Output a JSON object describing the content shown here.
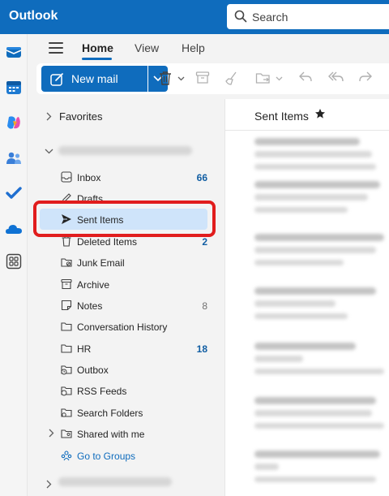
{
  "app": {
    "title": "Outlook"
  },
  "search": {
    "placeholder": "Search"
  },
  "rail": {
    "icons": [
      "mail-icon",
      "calendar-icon",
      "copilot-icon",
      "people-icon",
      "todo-icon",
      "onedrive-icon",
      "apps-icon"
    ]
  },
  "ribbon": {
    "tabs": [
      {
        "label": "Home",
        "active": true
      },
      {
        "label": "View",
        "active": false
      },
      {
        "label": "Help",
        "active": false
      }
    ]
  },
  "toolbar": {
    "new_mail_label": "New mail"
  },
  "folders": {
    "favorites_label": "Favorites",
    "items": [
      {
        "label": "Inbox",
        "count": "66",
        "icon": "inbox-icon"
      },
      {
        "label": "Drafts",
        "count": "",
        "icon": "drafts-icon"
      },
      {
        "label": "Sent Items",
        "count": "",
        "icon": "send-icon",
        "selected": true
      },
      {
        "label": "Deleted Items",
        "count": "2",
        "icon": "trash-icon"
      },
      {
        "label": "Junk Email",
        "count": "",
        "icon": "junk-icon"
      },
      {
        "label": "Archive",
        "count": "",
        "icon": "archive-icon"
      },
      {
        "label": "Notes",
        "count": "8",
        "icon": "notes-icon"
      },
      {
        "label": "Conversation History",
        "count": "",
        "icon": "folder-icon"
      },
      {
        "label": "HR",
        "count": "18",
        "icon": "folder-icon"
      },
      {
        "label": "Outbox",
        "count": "",
        "icon": "outbox-icon"
      },
      {
        "label": "RSS Feeds",
        "count": "",
        "icon": "rss-icon"
      },
      {
        "label": "Search Folders",
        "count": "",
        "icon": "search-folder-icon"
      },
      {
        "label": "Shared with me",
        "count": "",
        "icon": "shared-icon"
      },
      {
        "label": "Go to Groups",
        "count": "",
        "icon": "groups-icon"
      }
    ]
  },
  "message_list": {
    "title": "Sent Items"
  },
  "colors": {
    "brand": "#0f6cbd",
    "selected": "#cfe4fa",
    "highlight": "#e11d1d"
  }
}
